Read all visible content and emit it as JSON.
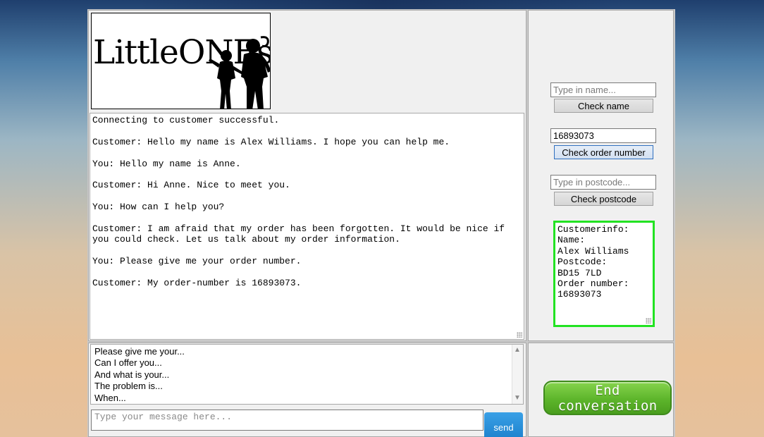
{
  "logo": {
    "text": "LittleONEs"
  },
  "chat_log": [
    "Connecting to customer successful.",
    "Customer: Hello my name is Alex Williams. I hope you can help me.",
    "You: Hello my name is Anne.",
    "Customer: Hi Anne. Nice to meet you.",
    "You: How can I help you?",
    "Customer: I am afraid that my order has been forgotten. It would be nice if you could check. Let us talk about my order information.",
    "You: Please give me your order number.",
    "Customer: My order-number is 16893073."
  ],
  "lookup": {
    "name_placeholder": "Type in name...",
    "check_name_label": "Check name",
    "order_value": "16893073",
    "check_order_label": "Check order number",
    "postcode_placeholder": "Type in postcode...",
    "check_postcode_label": "Check postcode"
  },
  "customer_info": {
    "heading": "Customerinfo:",
    "name_label": "Name:",
    "name_value": "Alex Williams",
    "postcode_label": "Postcode:",
    "postcode_value": "BD15 7LD",
    "order_label": "Order number:",
    "order_value": "16893073",
    "border_color": "#22e322"
  },
  "phrases": [
    "Please give me your...",
    "Can I offer you...",
    "And what is your...",
    "The problem is...",
    "When..."
  ],
  "composer": {
    "placeholder": "Type your message here...",
    "send_label": "send",
    "send_color": "#2a93dc"
  },
  "end_conversation_label": "End conversation",
  "end_button_color": "#5db52b"
}
